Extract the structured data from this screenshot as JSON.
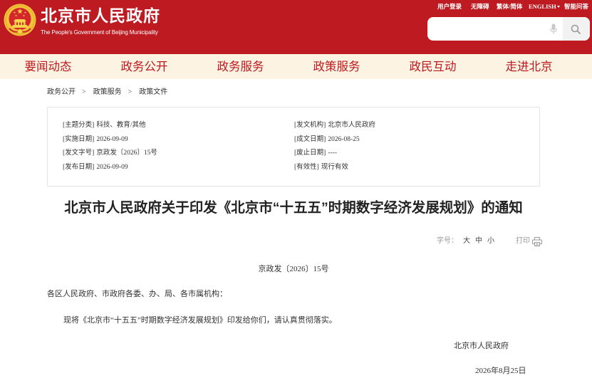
{
  "theme": {
    "brand_red": "#bd1a22",
    "nav_background": "#fcf3e2"
  },
  "header": {
    "logo_icon": "beijing-government-emblem",
    "site_title": "北京市人民政府",
    "site_subtitle": "The People's Government of Beijing Municipality",
    "top_links": [
      {
        "label": "用户登录"
      },
      {
        "label": "无障碍"
      },
      {
        "label": "繁体/简体"
      },
      {
        "label": "ENGLISH",
        "icon": "caret-down-icon"
      },
      {
        "label": "智能问答"
      }
    ],
    "search": {
      "value": "",
      "voice_icon": "microphone-icon",
      "submit_icon": "search-icon"
    }
  },
  "nav": {
    "items": [
      {
        "label": "要闻动态"
      },
      {
        "label": "政务公开"
      },
      {
        "label": "政务服务"
      },
      {
        "label": "政策服务"
      },
      {
        "label": "政民互动"
      },
      {
        "label": "走进北京"
      }
    ]
  },
  "breadcrumb": {
    "separator": ">",
    "items": [
      "政务公开",
      "政策服务",
      "政策文件"
    ]
  },
  "document_meta": {
    "left": [
      {
        "label": "[主题分类]",
        "value": "科技、教育/其他"
      },
      {
        "label": "[实施日期]",
        "value": "2026-09-09"
      },
      {
        "label": "[发文字号]",
        "value": "京政发〔2026〕15号"
      },
      {
        "label": "[发布日期]",
        "value": "2026-09-09"
      }
    ],
    "right": [
      {
        "label": "[发文机构]",
        "value": "北京市人民政府"
      },
      {
        "label": "[成文日期]",
        "value": "2026-08-25"
      },
      {
        "label": "[废止日期]",
        "value": "----"
      },
      {
        "label": "[有效性]",
        "value": "现行有效"
      }
    ]
  },
  "article": {
    "title": "北京市人民政府关于印发《北京市“十五五”时期数字经济发展规划》的通知",
    "tools": {
      "font_size_label": "字号：",
      "font_sizes": [
        "大",
        "中",
        "小"
      ],
      "print_label": "打印",
      "print_icon": "printer-icon"
    },
    "doc_number": "京政发〔2026〕15号",
    "salutation": "各区人民政府、市政府各委、办、局、各市属机构：",
    "paragraphs": [
      "现将《北京市“十五五”时期数字经济发展规划》印发给你们，请认真贯彻落实。"
    ],
    "signature": "北京市人民政府",
    "date": "2026年8月25日"
  }
}
